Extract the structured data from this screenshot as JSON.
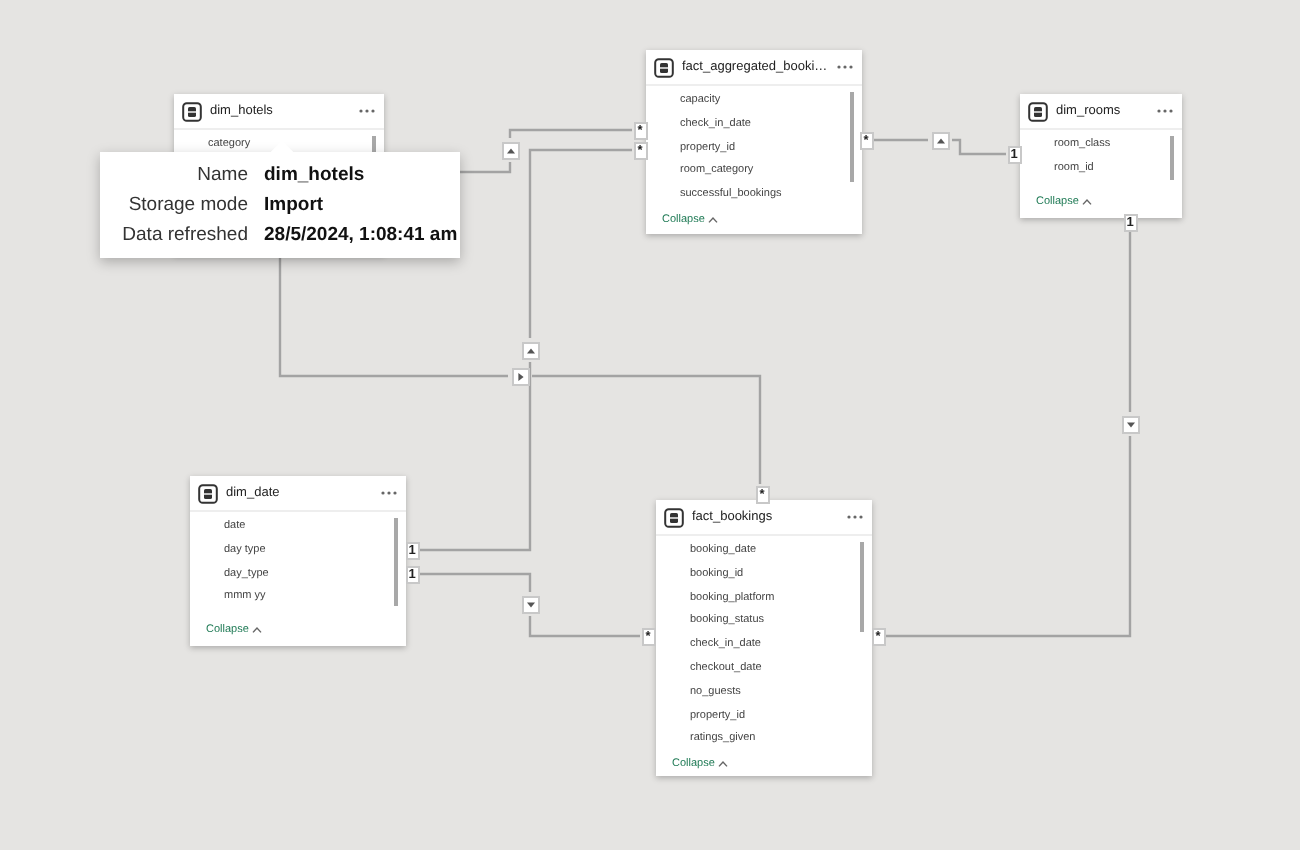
{
  "tables": [
    {
      "name": "dim_hotels",
      "fields": [
        "category"
      ]
    },
    {
      "name": "fact_aggregated_booki…",
      "fields": [
        "capacity",
        "check_in_date",
        "property_id",
        "room_category",
        "successful_bookings"
      ],
      "collapse": "Collapse"
    },
    {
      "name": "dim_rooms",
      "fields": [
        "room_class",
        "room_id"
      ],
      "collapse": "Collapse"
    },
    {
      "name": "dim_date",
      "fields": [
        "date",
        "day type",
        "day_type",
        "mmm yy"
      ],
      "collapse": "Collapse"
    },
    {
      "name": "fact_bookings",
      "fields": [
        "booking_date",
        "booking_id",
        "booking_platform",
        "booking_status",
        "check_in_date",
        "checkout_date",
        "no_guests",
        "property_id",
        "ratings_given"
      ],
      "collapse": "Collapse"
    }
  ],
  "relationships": [
    {
      "marks": [
        "*"
      ],
      "kind": "up"
    },
    {
      "marks": [
        "1",
        "*"
      ],
      "kind": "up"
    },
    {
      "marks": [
        "1",
        "*"
      ],
      "kind": "down"
    },
    {
      "marks": [
        "*"
      ],
      "kind": "right"
    },
    {
      "marks": [
        "*",
        "1"
      ],
      "kind": "up"
    },
    {
      "marks": [
        "1",
        "*"
      ],
      "kind": "down"
    }
  ],
  "tooltip": {
    "rows": [
      {
        "label": "Name",
        "value": "dim_hotels"
      },
      {
        "label": "Storage mode",
        "value": "Import"
      },
      {
        "label": "Data refreshed",
        "value": "28/5/2024, 1:08:41 am"
      }
    ]
  }
}
